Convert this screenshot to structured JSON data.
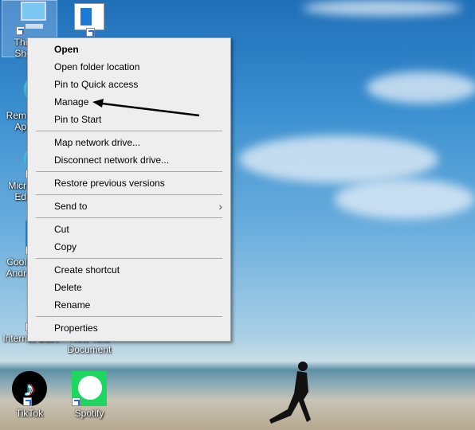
{
  "desktop_icons": [
    {
      "label": "This\nSho",
      "icon": "computer-icon"
    },
    {
      "label": "",
      "icon": "document-window-icon"
    },
    {
      "label": "Rem\nAp",
      "icon": "edge-icon"
    },
    {
      "label": "Micr\nEd",
      "icon": "edge-icon"
    },
    {
      "label": "Cool\nAndr",
      "icon": "app-icon"
    },
    {
      "label": "Internet Start",
      "icon": "blank-file-icon"
    },
    {
      "label": "New Text\nDocument",
      "icon": "text-file-icon"
    },
    {
      "label": "TikTok",
      "icon": "tiktok-icon"
    },
    {
      "label": "Spotify",
      "icon": "spotify-icon"
    }
  ],
  "context_menu": {
    "groups": [
      [
        "Open",
        "Open folder location",
        "Pin to Quick access",
        "Manage",
        "Pin to Start"
      ],
      [
        "Map network drive...",
        "Disconnect network drive..."
      ],
      [
        "Restore previous versions"
      ],
      [
        "Send to"
      ],
      [
        "Cut",
        "Copy"
      ],
      [
        "Create shortcut",
        "Delete",
        "Rename"
      ],
      [
        "Properties"
      ]
    ],
    "default_item": "Open",
    "submenu_item": "Send to",
    "highlighted_by_arrow": "Manage"
  },
  "colors": {
    "menu_bg": "#eeeeee",
    "arrow": "#000000"
  }
}
